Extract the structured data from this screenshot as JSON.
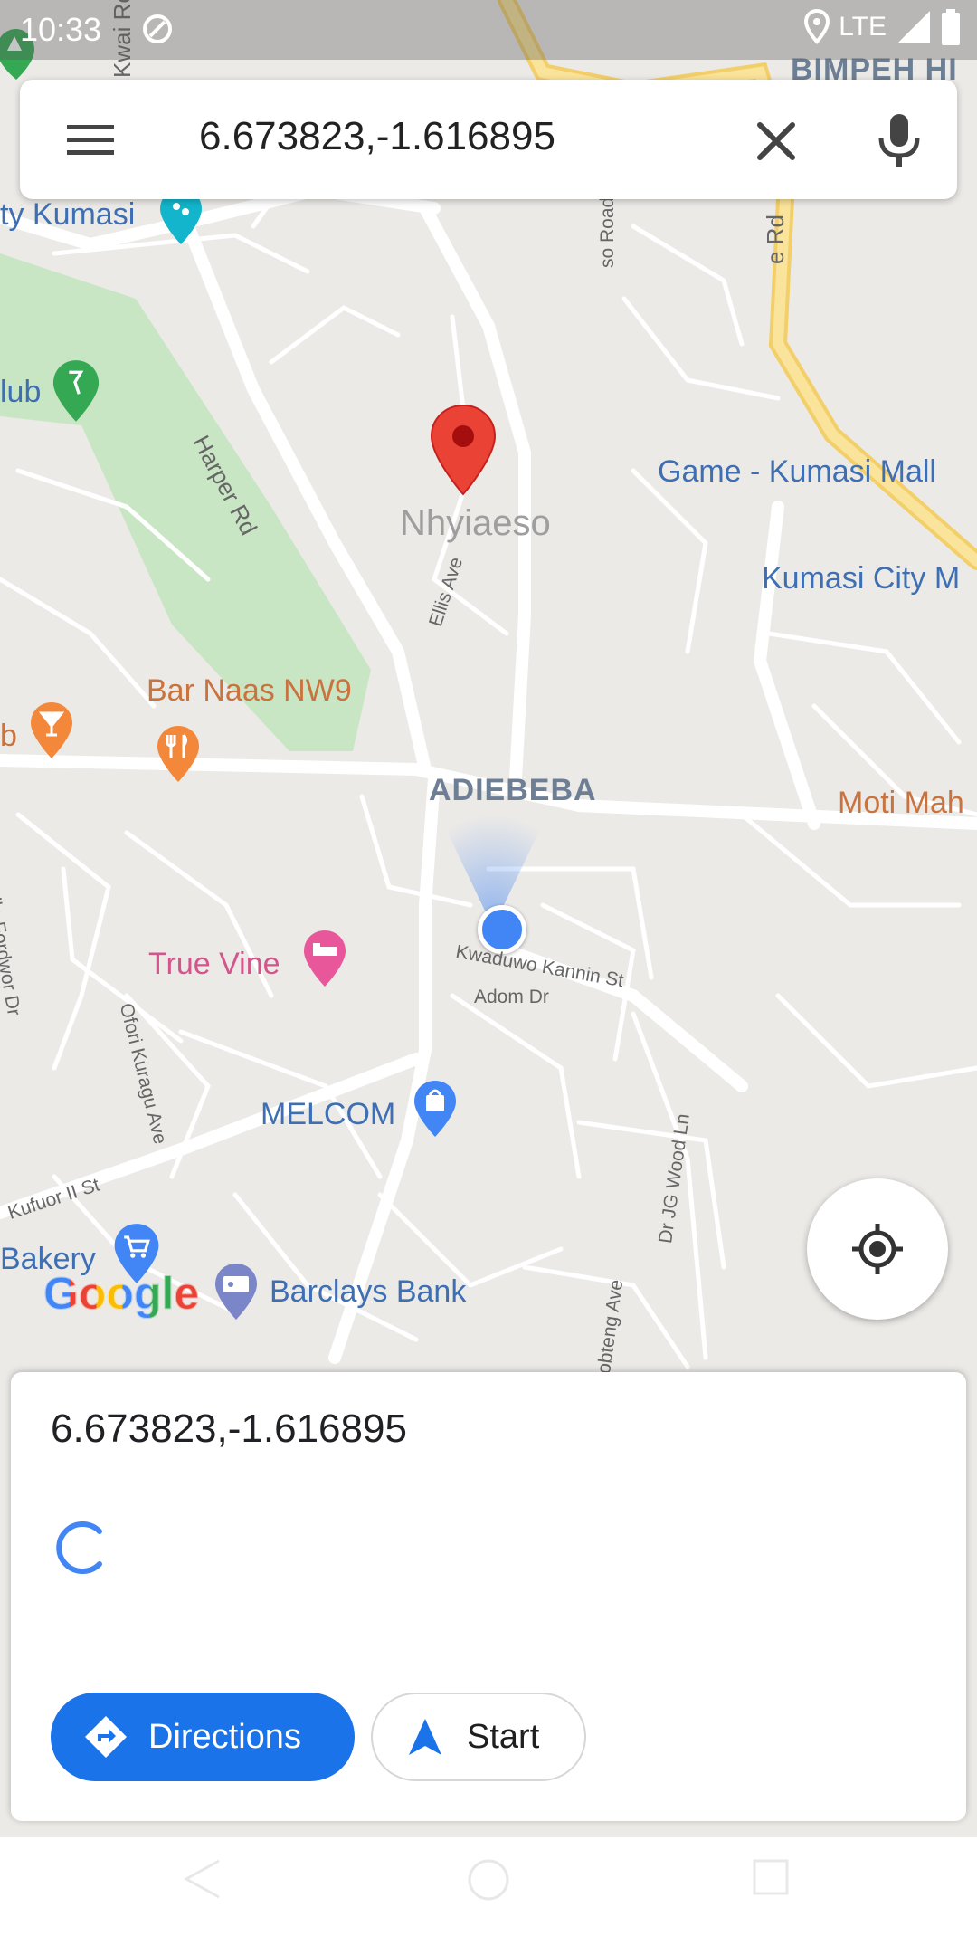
{
  "status_bar": {
    "time": "10:33",
    "network": "LTE"
  },
  "search": {
    "query": "6.673823,-1.616895"
  },
  "map": {
    "places": {
      "game_mall": "Game - Kumasi Mall",
      "kumasi_city": "Kumasi City M",
      "bar_naas": "Bar Naas NW9",
      "true_vine": "True Vine",
      "melcom": "MELCOM",
      "bakery": "Bakery",
      "barclays": "Barclays Bank",
      "moti": "Moti Mah",
      "kumasi_partial": "ty Kumasi",
      "club_partial": "lub",
      "bar_partial": "b",
      "bimpeh": "BIMPEH HI"
    },
    "pin_label": "Nhyiaeso",
    "neighborhood": "ADIEBEBA",
    "streets": {
      "harper": "Harper Rd",
      "ellis": "Ellis Ave",
      "kwaduwo": "Kwaduwo Kannin St",
      "adom": "Adom Dr",
      "ofori": "Ofori Kuragu Ave",
      "kufuor": "Kufuor II St",
      "jg_wood": "Dr JG Wood Ln",
      "bteng": "obteng Ave",
      "fordwor": "lla Fordwor Dr",
      "kwai": "Kwai Ro",
      "so_road": "so Road",
      "e_rd": "e Rd"
    },
    "logo": "Google",
    "colors": {
      "road_major": "#ffffff",
      "highway": "#f8d77b",
      "park": "#c9e6c4",
      "background": "#eceae7"
    }
  },
  "place_card": {
    "coordinates": "6.673823,-1.616895",
    "directions_label": "Directions",
    "start_label": "Start"
  },
  "icons": [
    "menu-icon",
    "clear-icon",
    "mic-icon",
    "my-location-icon",
    "directions-icon",
    "navigation-arrow-icon",
    "location-pin",
    "restaurant-icon",
    "bar-icon",
    "hotel-icon",
    "shopping-icon",
    "cart-icon",
    "atm-icon",
    "golf-icon"
  ]
}
